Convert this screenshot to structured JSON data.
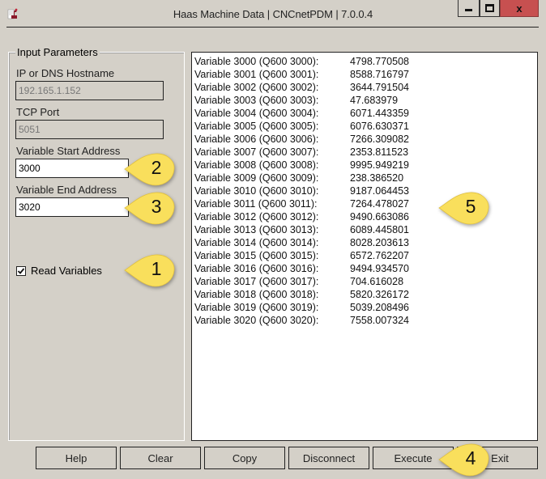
{
  "window": {
    "title": "Haas Machine Data | CNCnetPDM | 7.0.0.4",
    "icon": "app-icon",
    "controls": {
      "minimize": "minimize-icon",
      "maximize": "maximize-icon",
      "close": "close-icon"
    }
  },
  "input_parameters": {
    "legend": "Input Parameters",
    "hostname": {
      "label": "IP or DNS Hostname",
      "value": "192.165.1.152"
    },
    "tcp_port": {
      "label": "TCP Port",
      "value": "5051"
    },
    "start_address": {
      "label": "Variable Start Address",
      "value": "3000"
    },
    "end_address": {
      "label": "Variable End Address",
      "value": "3020"
    },
    "read_variables": {
      "label": "Read Variables",
      "checked": true
    }
  },
  "output": {
    "rows": [
      {
        "name": "Variable 3000 (Q600 3000):",
        "value": "4798.770508"
      },
      {
        "name": "Variable 3001 (Q600 3001):",
        "value": "8588.716797"
      },
      {
        "name": "Variable 3002 (Q600 3002):",
        "value": "3644.791504"
      },
      {
        "name": "Variable 3003 (Q600 3003):",
        "value": "47.683979"
      },
      {
        "name": "Variable 3004 (Q600 3004):",
        "value": "6071.443359"
      },
      {
        "name": "Variable 3005 (Q600 3005):",
        "value": "6076.630371"
      },
      {
        "name": "Variable 3006 (Q600 3006):",
        "value": "7266.309082"
      },
      {
        "name": "Variable 3007 (Q600 3007):",
        "value": "2353.811523"
      },
      {
        "name": "Variable 3008 (Q600 3008):",
        "value": "9995.949219"
      },
      {
        "name": "Variable 3009 (Q600 3009):",
        "value": "238.386520"
      },
      {
        "name": "Variable 3010 (Q600 3010):",
        "value": "9187.064453"
      },
      {
        "name": "Variable 3011 (Q600 3011):",
        "value": "7264.478027"
      },
      {
        "name": "Variable 3012 (Q600 3012):",
        "value": "9490.663086"
      },
      {
        "name": "Variable 3013 (Q600 3013):",
        "value": "6089.445801"
      },
      {
        "name": "Variable 3014 (Q600 3014):",
        "value": "8028.203613"
      },
      {
        "name": "Variable 3015 (Q600 3015):",
        "value": "6572.762207"
      },
      {
        "name": "Variable 3016 (Q600 3016):",
        "value": "9494.934570"
      },
      {
        "name": "Variable 3017 (Q600 3017):",
        "value": "704.616028"
      },
      {
        "name": "Variable 3018 (Q600 3018):",
        "value": "5820.326172"
      },
      {
        "name": "Variable 3019 (Q600 3019):",
        "value": "5039.208496"
      },
      {
        "name": "Variable 3020 (Q600 3020):",
        "value": "7558.007324"
      }
    ]
  },
  "buttons": {
    "help": "Help",
    "clear": "Clear",
    "copy": "Copy",
    "disconnect": "Disconnect",
    "execute": "Execute",
    "exit": "Exit"
  },
  "callouts": {
    "one": "1",
    "two": "2",
    "three": "3",
    "four": "4",
    "five": "5",
    "color": "#f9df5c"
  }
}
